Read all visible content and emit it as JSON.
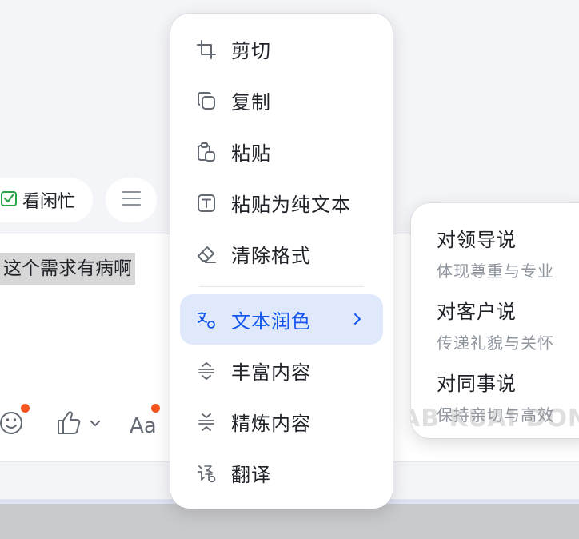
{
  "toolbar": {
    "busy_label": "看闲忙"
  },
  "editor": {
    "selected_text": "这个需求有病啊"
  },
  "context_menu": {
    "items": [
      {
        "label": "剪切",
        "icon": "crop-icon"
      },
      {
        "label": "复制",
        "icon": "copy-icon"
      },
      {
        "label": "粘贴",
        "icon": "paste-icon"
      },
      {
        "label": "粘贴为纯文本",
        "icon": "plain-text-icon"
      },
      {
        "label": "清除格式",
        "icon": "eraser-icon"
      },
      {
        "label": "文本润色",
        "icon": "text-polish-icon",
        "active": true
      },
      {
        "label": "丰富内容",
        "icon": "expand-icon"
      },
      {
        "label": "精炼内容",
        "icon": "condense-icon"
      },
      {
        "label": "翻译",
        "icon": "translate-icon"
      }
    ]
  },
  "submenu": {
    "items": [
      {
        "title": "对领导说",
        "desc": "体现尊重与专业"
      },
      {
        "title": "对客户说",
        "desc": "传递礼貌与关怀"
      },
      {
        "title": "对同事说",
        "desc": "保持亲切与高效"
      }
    ],
    "watermark": "AB KUAI DONG"
  },
  "colors": {
    "accent": "#1456f0",
    "active_bg": "#e0e9fb",
    "notification_dot": "#f5541f",
    "check_green": "#2aa34a"
  }
}
